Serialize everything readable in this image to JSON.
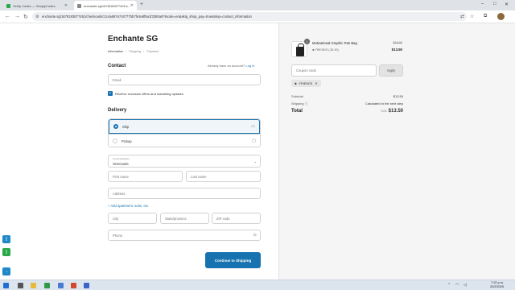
{
  "browser": {
    "tabs": [
      {
        "title": "Verify Codes — SimplyCodes",
        "active": false,
        "color": "#2aa84a"
      },
      {
        "title": "enchante.sg/1678183877451/c...",
        "active": true,
        "color": "#888888"
      }
    ],
    "url": "enchante.sg/1678183877451/checkouts/c2c4a687e7c67775b7fe3e8f5a1f3360a8?locale=en&skip_shop_pay=true&step=contact_information"
  },
  "checkout": {
    "store_name": "Enchante SG",
    "breadcrumbs": [
      "Information",
      "Shipping",
      "Payment"
    ],
    "contact_heading": "Contact",
    "account_prompt": "Already have an account?",
    "login_label": "Log in",
    "email_placeholder": "Email",
    "marketing_label": "Receive exclusive offers and marketing updates",
    "delivery_heading": "Delivery",
    "delivery_options": [
      {
        "label": "Ship",
        "selected": true
      },
      {
        "label": "Pickup",
        "selected": false
      }
    ],
    "country_label": "Country/Region",
    "country_value": "Venezuela",
    "first_name_placeholder": "First name",
    "last_name_placeholder": "Last name",
    "address_placeholder": "Address",
    "add_apartment_label": "+ Add apartment, suite, etc.",
    "city_placeholder": "City",
    "state_placeholder": "State/province",
    "zip_placeholder": "ZIP code",
    "phone_placeholder": "Phone",
    "continue_label": "Continue to Shipping"
  },
  "summary": {
    "product_name": "Motivational Graphic Tote Bag",
    "quantity": "1",
    "discount_line": "FRIENDS (-$1.50)",
    "original_price": "$15.00",
    "price": "$13.50",
    "coupon_placeholder": "Coupon code",
    "apply_label": "Apply",
    "applied_code": "FRIENDS",
    "subtotal_label": "Subtotal",
    "subtotal_value": "$13.50",
    "shipping_label": "Shipping",
    "shipping_value": "Calculated in the next step",
    "total_label": "Total",
    "currency": "SGD",
    "total_value": "$13.50"
  },
  "taskbar": {
    "time": "7:22 p.m.",
    "date": "20/2/2025"
  },
  "colors": {
    "accent": "#1773b0",
    "summary_bg": "#f5f5f5"
  }
}
